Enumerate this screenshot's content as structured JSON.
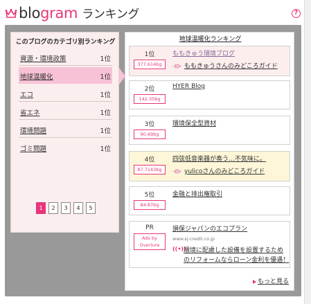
{
  "header": {
    "logo_prefix": "blo",
    "logo_accent": "gram",
    "logo_suffix": "ランキング",
    "help_label": "?",
    "accent_color": "#e8357a"
  },
  "category_panel": {
    "title": "このブログのカテゴリ別ランキング",
    "items": [
      {
        "label": "資源・環境政策",
        "rank": "1位"
      },
      {
        "label": "地球温暖化",
        "rank": "1位",
        "active": true
      },
      {
        "label": "エコ",
        "rank": "1位"
      },
      {
        "label": "省エネ",
        "rank": "1位"
      },
      {
        "label": "環境問題",
        "rank": "1位"
      },
      {
        "label": "ゴミ問題",
        "rank": "1位"
      }
    ],
    "pages": [
      "1",
      "2",
      "3",
      "4",
      "5"
    ],
    "current_page": "1"
  },
  "ranking_panel": {
    "title": "地球温暖化ランキング",
    "entries": [
      {
        "rank": "1位",
        "score": "377.614bg",
        "title": "ももきゅう環境ブログ",
        "sub": "ももきゅうさんのみどころガイド",
        "bg": "pink"
      },
      {
        "rank": "2位",
        "score": "142.35bg",
        "title": "HYER Blog"
      },
      {
        "rank": "3位",
        "score": "90.69bg",
        "title": "環境保全型資材"
      },
      {
        "rank": "4位",
        "score": "87.7143bg",
        "title": "四弦低音楽器が奏う…不気味に。",
        "sub": "yulicoさんのみどころガイド",
        "bg": "yellow"
      },
      {
        "rank": "5位",
        "score": "84.87bg",
        "title": "金融と排出権取引"
      }
    ],
    "ad": {
      "label": "PR",
      "badge_line1": "Ads by",
      "badge_line2": "Overture",
      "title": "損保ジャパンのエコプラン",
      "url": "www.sj-credit.co.jp",
      "line1": "環境に配慮した設備を設置するため",
      "line2": "のリフォームならローン金利を優遇！"
    },
    "more_label": "もっと見る"
  }
}
